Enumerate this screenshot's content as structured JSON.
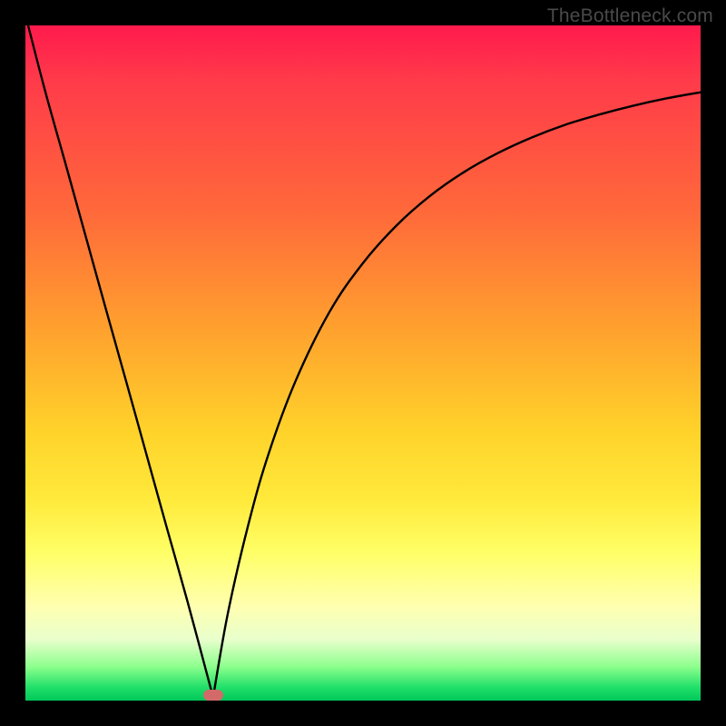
{
  "watermark": "TheBottleneck.com",
  "chart_data": {
    "type": "line",
    "title": "",
    "xlabel": "",
    "ylabel": "",
    "xlim": [
      0,
      100
    ],
    "ylim": [
      0,
      100
    ],
    "grid": false,
    "legend": false,
    "notes": "V-shaped bottleneck curve. Left branch is a near-linear descent; right branch is a concave asymptotic rise. A small rounded marker sits at the curve minimum near the x-axis.",
    "minimum": {
      "x": 27.8,
      "y": 0.5
    },
    "marker": {
      "x": 27.8,
      "y": 0.8
    },
    "series": [
      {
        "name": "left-branch",
        "x": [
          0.4,
          3,
          6,
          9,
          12,
          15,
          18,
          21,
          24,
          27.8
        ],
        "values": [
          100,
          90,
          79.3,
          68.5,
          57.7,
          47,
          36.2,
          25.4,
          14.7,
          0.5
        ]
      },
      {
        "name": "right-branch",
        "x": [
          27.8,
          30,
          33,
          36,
          40,
          45,
          50,
          55,
          60,
          65,
          70,
          75,
          80,
          85,
          90,
          95,
          100
        ],
        "values": [
          0.5,
          13,
          26,
          36.5,
          47.3,
          57.5,
          64.8,
          70.4,
          74.8,
          78.3,
          81.1,
          83.4,
          85.3,
          86.8,
          88.1,
          89.2,
          90.1
        ]
      }
    ]
  }
}
